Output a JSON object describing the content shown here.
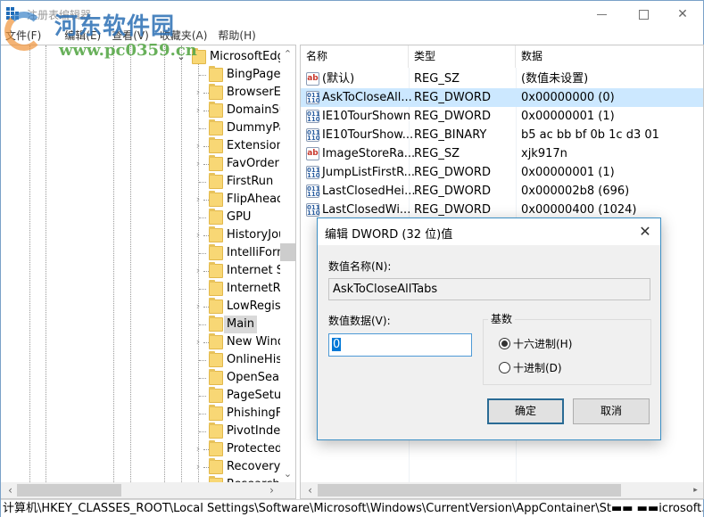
{
  "window": {
    "title": "注册表编辑器",
    "minimize_icon": "minimize-icon",
    "maximize_icon": "maximize-icon",
    "close_icon": "close-icon"
  },
  "watermark": {
    "title": "河东软件园",
    "url": "www.pc0359.cn"
  },
  "menu": [
    {
      "label": "文件(F)"
    },
    {
      "label": "编辑(E)"
    },
    {
      "label": "查看(V)"
    },
    {
      "label": "收藏夹(A)"
    },
    {
      "label": "帮助(H)"
    }
  ],
  "tree": {
    "parent": {
      "label": "MicrosoftEdge",
      "expanded": true
    },
    "items": [
      {
        "label": "BingPageData",
        "expandable": false,
        "selected": false
      },
      {
        "label": "BrowserEmulation",
        "expandable": true,
        "selected": false
      },
      {
        "label": "DomainSuggestion",
        "expandable": true,
        "selected": false
      },
      {
        "label": "DummyPath",
        "expandable": false,
        "selected": false
      },
      {
        "label": "Extensions",
        "expandable": true,
        "selected": false
      },
      {
        "label": "FavOrder",
        "expandable": true,
        "selected": false
      },
      {
        "label": "FirstRun",
        "expandable": false,
        "selected": false
      },
      {
        "label": "FlipAhead",
        "expandable": true,
        "selected": false
      },
      {
        "label": "GPU",
        "expandable": false,
        "selected": false
      },
      {
        "label": "HistoryJournal",
        "expandable": true,
        "selected": false
      },
      {
        "label": "IntelliForms",
        "expandable": false,
        "selected": false
      },
      {
        "label": "Internet Settings",
        "expandable": true,
        "selected": false
      },
      {
        "label": "InternetRegistry",
        "expandable": false,
        "selected": false
      },
      {
        "label": "LowRegistry",
        "expandable": true,
        "selected": false
      },
      {
        "label": "Main",
        "expandable": false,
        "selected": true
      },
      {
        "label": "New Windows",
        "expandable": true,
        "selected": false
      },
      {
        "label": "OnlineHistory",
        "expandable": false,
        "selected": false
      },
      {
        "label": "OpenSearch",
        "expandable": false,
        "selected": false
      },
      {
        "label": "PageSetup",
        "expandable": false,
        "selected": false
      },
      {
        "label": "PhishingFilter",
        "expandable": false,
        "selected": false
      },
      {
        "label": "PivotIndex",
        "expandable": false,
        "selected": false
      },
      {
        "label": "Protected",
        "expandable": true,
        "selected": false
      },
      {
        "label": "Recovery",
        "expandable": true,
        "selected": false
      },
      {
        "label": "Research",
        "expandable": false,
        "selected": false
      }
    ]
  },
  "values": {
    "columns": [
      "名称",
      "类型",
      "数据"
    ],
    "rows": [
      {
        "icon": "string-value-icon",
        "kind": "sz",
        "name": "(默认)",
        "type": "REG_SZ",
        "data": "(数值未设置)",
        "selected": false
      },
      {
        "icon": "binary-value-icon",
        "kind": "bin",
        "name": "AskToCloseAll...",
        "type": "REG_DWORD",
        "data": "0x00000000 (0)",
        "selected": true
      },
      {
        "icon": "binary-value-icon",
        "kind": "bin",
        "name": "IE10TourShown",
        "type": "REG_DWORD",
        "data": "0x00000001 (1)",
        "selected": false
      },
      {
        "icon": "binary-value-icon",
        "kind": "bin",
        "name": "IE10TourShow...",
        "type": "REG_BINARY",
        "data": "b5 ac bb bf 0b 1c d3 01",
        "selected": false
      },
      {
        "icon": "string-value-icon",
        "kind": "sz",
        "name": "ImageStoreRa...",
        "type": "REG_SZ",
        "data": "xjk917n",
        "selected": false
      },
      {
        "icon": "binary-value-icon",
        "kind": "bin",
        "name": "JumpListFirstR...",
        "type": "REG_DWORD",
        "data": "0x00000001 (1)",
        "selected": false
      },
      {
        "icon": "binary-value-icon",
        "kind": "bin",
        "name": "LastClosedHei...",
        "type": "REG_DWORD",
        "data": "0x000002b8 (696)",
        "selected": false
      },
      {
        "icon": "binary-value-icon",
        "kind": "bin",
        "name": "LastClosedWi...",
        "type": "REG_DWORD",
        "data": "0x00000400 (1024)",
        "selected": false
      }
    ]
  },
  "statusbar": {
    "path": "计算机\\HKEY_CLASSES_ROOT\\Local Settings\\Software\\Microsoft\\Windows\\CurrentVersion\\AppContainer\\St▬▬ ▬▬icrosoft.microsoft"
  },
  "dialog": {
    "title": "编辑 DWORD (32 位)值",
    "name_label": "数值名称(N):",
    "name_value": "AskToCloseAllTabs",
    "data_label": "数值数据(V):",
    "data_value": "0",
    "base_label": "基数",
    "radios": [
      {
        "label": "十六进制(H)",
        "checked": true
      },
      {
        "label": "十进制(D)",
        "checked": false
      }
    ],
    "ok_label": "确定",
    "cancel_label": "取消"
  }
}
